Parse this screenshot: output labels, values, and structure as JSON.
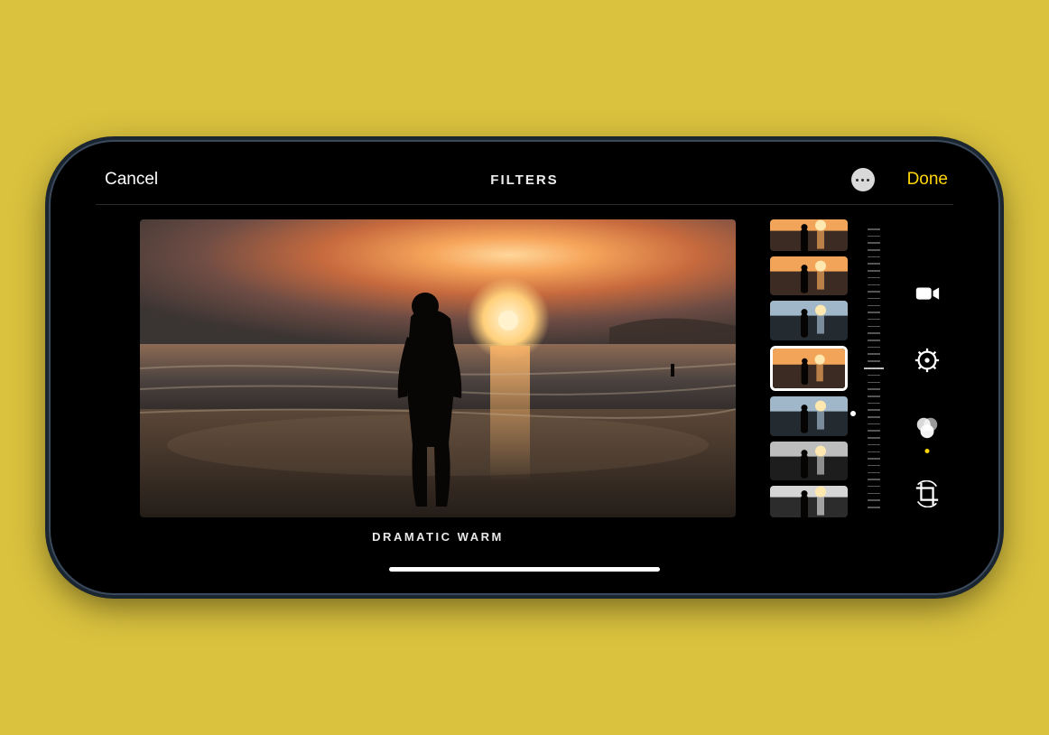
{
  "colors": {
    "background": "#dac23e",
    "accent": "#ffd60a"
  },
  "topbar": {
    "cancel_label": "Cancel",
    "title": "FILTERS",
    "done_label": "Done"
  },
  "preview": {
    "filter_label": "DRAMATIC WARM"
  },
  "filter_thumbs": {
    "selected_index": 3,
    "items": [
      {
        "name": "vivid",
        "palette": "warm"
      },
      {
        "name": "vivid-warm",
        "palette": "warm"
      },
      {
        "name": "vivid-cool",
        "palette": "cool"
      },
      {
        "name": "dramatic-warm",
        "palette": "warm"
      },
      {
        "name": "dramatic-cool",
        "palette": "cool"
      },
      {
        "name": "mono",
        "palette": "mono"
      },
      {
        "name": "silvertone",
        "palette": "mono2"
      }
    ]
  },
  "slider": {
    "value_position": 0.65
  },
  "tools": [
    {
      "name": "video-tool",
      "icon": "video",
      "active": false
    },
    {
      "name": "adjust-tool",
      "icon": "adjust",
      "active": false
    },
    {
      "name": "filters-tool",
      "icon": "filters",
      "active": true
    },
    {
      "name": "crop-tool",
      "icon": "crop",
      "active": false
    }
  ]
}
